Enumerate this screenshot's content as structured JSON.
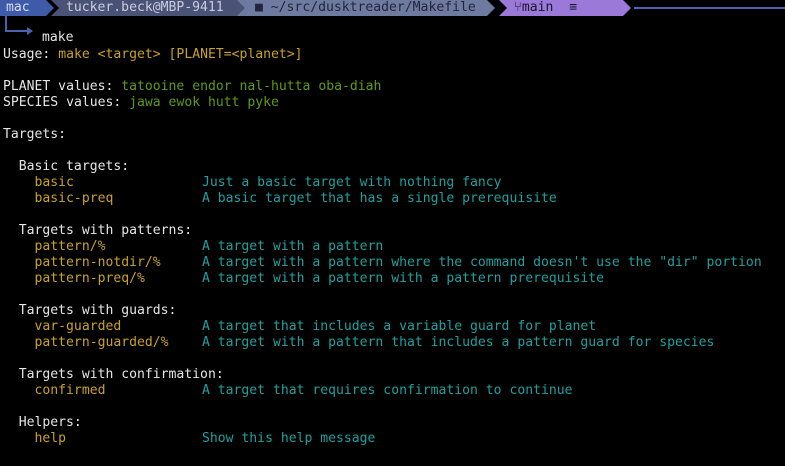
{
  "prompt": {
    "os": "mac",
    "host": "tucker.beck@MBP-9411",
    "folder_icon": "folder-icon",
    "path": "~/src/dusktreader/Makefile",
    "branch_icon": "git-branch-icon",
    "branch": "main",
    "status": "≡",
    "command": "make"
  },
  "usage": {
    "label": "Usage: ",
    "value": "make <target> [PLANET=<planet>]"
  },
  "planet": {
    "label": "PLANET values: ",
    "value": "tatooine endor nal-hutta oba-diah"
  },
  "species": {
    "label": "SPECIES values: ",
    "value": "jawa ewok hutt pyke"
  },
  "targets_heading": "Targets:",
  "groups": [
    {
      "title": "Basic targets:",
      "items": [
        {
          "name": "basic",
          "desc": "Just a basic target with nothing fancy"
        },
        {
          "name": "basic-preq",
          "desc": "A basic target that has a single prerequisite"
        }
      ]
    },
    {
      "title": "Targets with patterns:",
      "items": [
        {
          "name": "pattern/%",
          "desc": "A target with a pattern"
        },
        {
          "name": "pattern-notdir/%",
          "desc": "A target with a pattern where the command doesn't use the \"dir\" portion"
        },
        {
          "name": "pattern-preq/%",
          "desc": "A target with a pattern with a pattern prerequisite"
        }
      ]
    },
    {
      "title": "Targets with guards:",
      "items": [
        {
          "name": "var-guarded",
          "desc": "A target that includes a variable guard for planet"
        },
        {
          "name": "pattern-guarded/%",
          "desc": "A target with a pattern that includes a pattern guard for species"
        }
      ]
    },
    {
      "title": "Targets with confirmation:",
      "items": [
        {
          "name": "confirmed",
          "desc": "A target that requires confirmation to continue"
        }
      ]
    },
    {
      "title": "Helpers:",
      "items": [
        {
          "name": "help",
          "desc": "Show this help message"
        }
      ]
    }
  ]
}
